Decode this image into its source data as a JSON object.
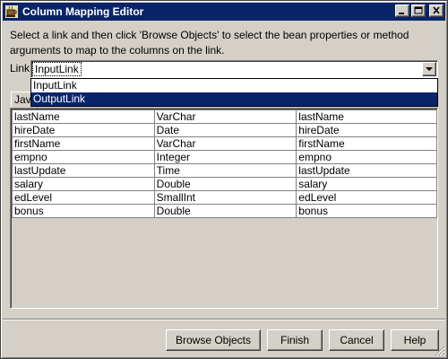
{
  "window": {
    "title": "Column Mapping Editor"
  },
  "instructions": "Select a link and then click 'Browse Objects' to select the bean properties or method arguments to map to the columns on the link.",
  "link": {
    "label": "Link:",
    "selected": "InputLink",
    "options": [
      "InputLink",
      "OutputLink"
    ],
    "highlighted": "OutputLink"
  },
  "tab": {
    "label": "Jav"
  },
  "table": {
    "rows": [
      [
        "lastName",
        "VarChar",
        "lastName"
      ],
      [
        "hireDate",
        "Date",
        "hireDate"
      ],
      [
        "firstName",
        "VarChar",
        "firstName"
      ],
      [
        "empno",
        "Integer",
        "empno"
      ],
      [
        "lastUpdate",
        "Time",
        "lastUpdate"
      ],
      [
        "salary",
        "Double",
        "salary"
      ],
      [
        "edLevel",
        "SmallInt",
        "edLevel"
      ],
      [
        "bonus",
        "Double",
        "bonus"
      ]
    ]
  },
  "buttons": {
    "browse": "Browse Objects",
    "finish": "Finish",
    "cancel": "Cancel",
    "help": "Help"
  },
  "colors": {
    "titlebar": "#0a246a",
    "face": "#d4d0c8",
    "selection": "#0a246a"
  }
}
